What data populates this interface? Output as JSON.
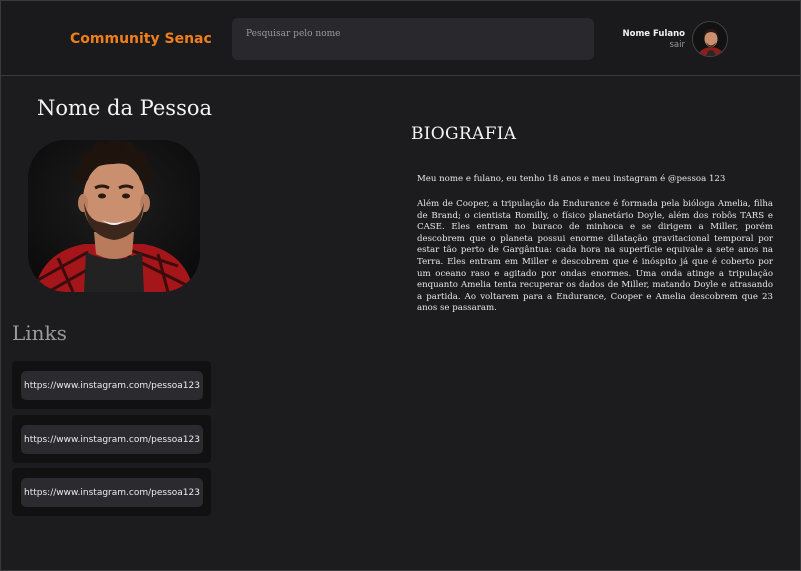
{
  "header": {
    "brand": "Community Senac",
    "search_placeholder": "Pesquisar pelo nome",
    "user_name": "Nome Fulano",
    "logout_label": "sair"
  },
  "profile": {
    "name": "Nome da Pessoa",
    "links_title": "Links",
    "links": [
      "https://www.instagram.com/pessoa123",
      "https://www.instagram.com/pessoa123",
      "https://www.instagram.com/pessoa123"
    ]
  },
  "bio": {
    "title": "BIOGRAFIA",
    "intro": "Meu nome e fulano, eu tenho 18 anos e meu instagram  é @pessoa 123",
    "text": "Além de Cooper, a tripulação da Endurance é formada pela bióloga Amelia, filha de Brand; o cientista Romilly, o físico planetário Doyle, além dos robôs TARS e CASE. Eles entram no buraco de minhoca e se dirigem a Miller, porém descobrem que o planeta possui enorme dilatação gravitacional temporal por estar tão perto de Gargântua: cada hora na superfície equivale a sete anos na Terra. Eles entram em Miller e descobrem que é inóspito já que é coberto por um oceano raso e agitado por ondas enormes. Uma onda atinge a tripulação enquanto Amelia tenta recuperar os dados de Miller, matando Doyle e atrasando a partida. Ao voltarem para a Endurance, Cooper e Amelia descobrem que 23 anos se passaram."
  },
  "colors": {
    "background": "#1c1c1e",
    "brand": "#f07f1a",
    "card": "#111112",
    "link_button": "#2b2b2f"
  }
}
